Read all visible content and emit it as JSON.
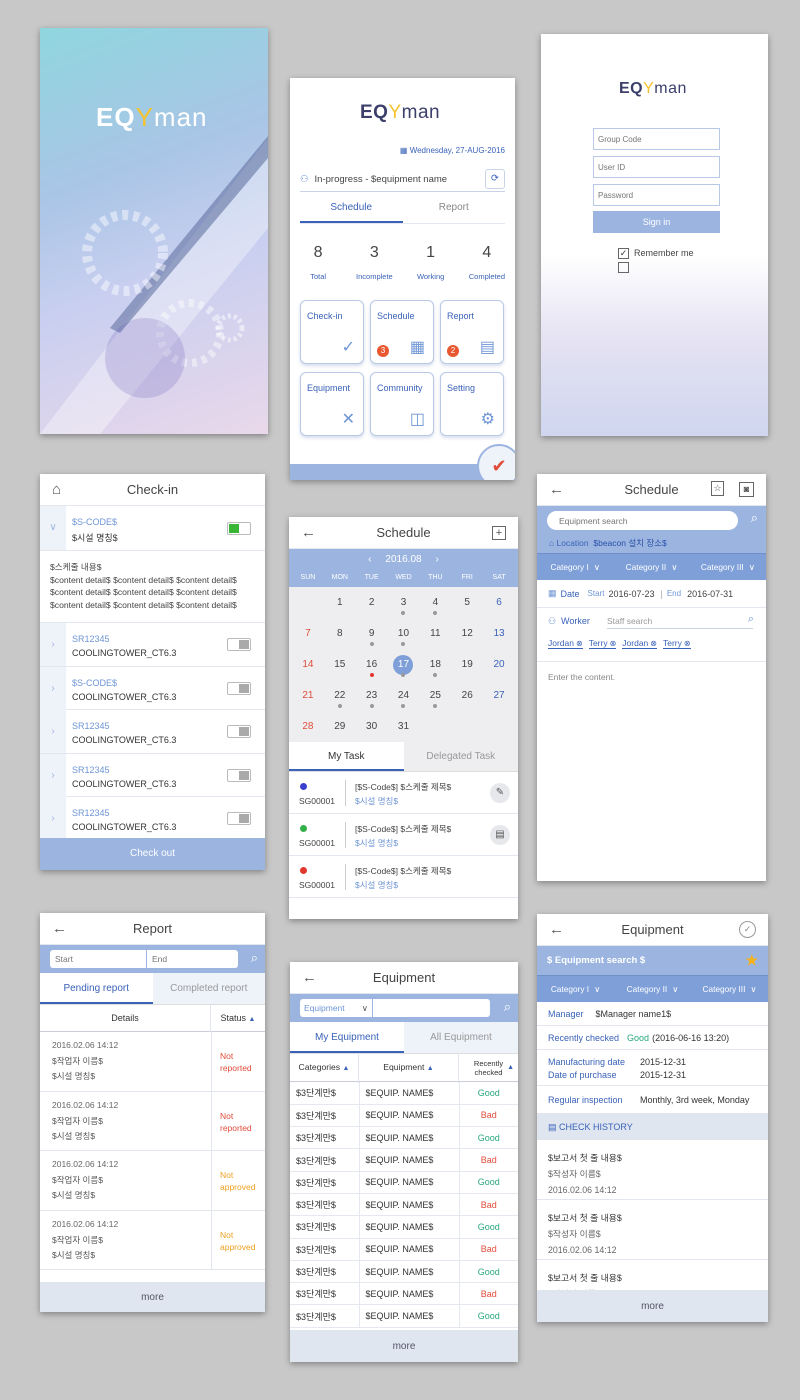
{
  "s1": {
    "logo_a": "EQ",
    "logo_b": "man"
  },
  "s2": {
    "logo_a": "EQ",
    "logo_b": "man",
    "date": "Wednesday, 27-AUG-2016",
    "status": "In-progress - $equipment name",
    "tabs": [
      "Schedule",
      "Report"
    ],
    "stats": [
      {
        "v": "8",
        "l": "Total"
      },
      {
        "v": "3",
        "l": "Incomplete"
      },
      {
        "v": "1",
        "l": "Working"
      },
      {
        "v": "4",
        "l": "Completed"
      }
    ],
    "tiles": [
      {
        "t": "Check-in",
        "ic": "✓",
        "b": ""
      },
      {
        "t": "Schedule",
        "ic": "▦",
        "b": "3"
      },
      {
        "t": "Report",
        "ic": "▤",
        "b": "2"
      },
      {
        "t": "Equipment",
        "ic": "✕",
        "b": ""
      },
      {
        "t": "Community",
        "ic": "◫",
        "b": ""
      },
      {
        "t": "Setting",
        "ic": "⚙",
        "b": ""
      }
    ]
  },
  "s3": {
    "logo_a": "EQ",
    "logo_b": "man",
    "group_ph": "Group Code",
    "user_ph": "User ID",
    "pw_ph": "Password",
    "signin": "Sign in",
    "remember": "Remember me"
  },
  "s4": {
    "title": "Check-in",
    "first": {
      "code": "$S-CODE$",
      "name": "$시설 명칭$"
    },
    "detail_head": "$스케줄 내용$",
    "detail_lines": [
      "$content detail$ $content detail$ $content detail$",
      "$content detail$ $content detail$ $content detail$",
      "$content detail$ $content detail$ $content detail$"
    ],
    "items": [
      {
        "code": "SR12345",
        "name": "COOLINGTOWER_CT6.3"
      },
      {
        "code": "$S-CODE$",
        "name": "COOLINGTOWER_CT6.3"
      },
      {
        "code": "SR12345",
        "name": "COOLINGTOWER_CT6.3"
      },
      {
        "code": "SR12345",
        "name": "COOLINGTOWER_CT6.3"
      },
      {
        "code": "SR12345",
        "name": "COOLINGTOWER_CT6.3"
      }
    ],
    "checkout": "Check out"
  },
  "s5": {
    "title": "Schedule",
    "month": "2016.08",
    "days": [
      "SUN",
      "MON",
      "TUE",
      "WED",
      "THU",
      "FRI",
      "SAT"
    ],
    "weeks": [
      [
        "",
        "1",
        "2",
        "3",
        "4",
        "5",
        "6"
      ],
      [
        "7",
        "8",
        "9",
        "10",
        "11",
        "12",
        "13"
      ],
      [
        "14",
        "15",
        "16",
        "17",
        "18",
        "19",
        "20"
      ],
      [
        "21",
        "22",
        "23",
        "24",
        "25",
        "26",
        "27"
      ],
      [
        "28",
        "29",
        "30",
        "31",
        "",
        "",
        ""
      ]
    ],
    "tabs": [
      "My Task",
      "Delegated Task"
    ],
    "tasks": [
      {
        "code": "SG00001",
        "title": "[$S-Code$] $스케줄 제목$",
        "sub": "$시설 명칭$",
        "dot": "#3b3fd0"
      },
      {
        "code": "SG00001",
        "title": "[$S-Code$] $스케줄 제목$",
        "sub": "$시설 명칭$",
        "dot": "#33b04a"
      },
      {
        "code": "SG00001",
        "title": "[$S-Code$] $스케줄 제목$",
        "sub": "$시설 명칭$",
        "dot": "#e0382f"
      }
    ]
  },
  "s6": {
    "title": "Schedule",
    "search_ph": "Equipment search",
    "loc_label": "Location",
    "loc_val": "$beacon 설치 장소$",
    "cats": [
      "Category I",
      "Category II",
      "Category III"
    ],
    "date_label": "Date",
    "start_label": "Start",
    "start": "2016-07-23",
    "end_label": "End",
    "end": "2016-07-31",
    "worker_label": "Worker",
    "staff_ph": "Staff search",
    "chips": [
      "Jordan",
      "Terry",
      "Jordan",
      "Terry"
    ],
    "content_ph": "Enter the content."
  },
  "s7": {
    "title": "Report",
    "start_ph": "Start",
    "end_ph": "End",
    "tabs": [
      "Pending report",
      "Completed report"
    ],
    "col_details": "Details",
    "col_status": "Status",
    "rows": [
      {
        "date": "2016.02.06 14:12",
        "worker": "$작업자 이름$",
        "name": "$시설 명칭$",
        "status": "Not reported",
        "c": "#e04c3a"
      },
      {
        "date": "2016.02.06 14:12",
        "worker": "$작업자 이름$",
        "name": "$시설 명칭$",
        "status": "Not reported",
        "c": "#e04c3a"
      },
      {
        "date": "2016.02.06 14:12",
        "worker": "$작업자 이름$",
        "name": "$시설 명칭$",
        "status": "Not approved",
        "c": "#f0a020"
      },
      {
        "date": "2016.02.06 14:12",
        "worker": "$작업자 이름$",
        "name": "$시설 명칭$",
        "status": "Not approved",
        "c": "#f0a020"
      }
    ],
    "more": "more"
  },
  "s8": {
    "title": "Equipment",
    "select": "Equipment",
    "tabs": [
      "My Equipment",
      "All Equipment"
    ],
    "cols": [
      "Categories",
      "Equipment",
      "Recently checked"
    ],
    "rows": [
      [
        "$3단계만$",
        "$EQUIP. NAME$",
        "Good"
      ],
      [
        "$3단계만$",
        "$EQUIP. NAME$",
        "Bad"
      ],
      [
        "$3단계만$",
        "$EQUIP. NAME$",
        "Good"
      ],
      [
        "$3단계만$",
        "$EQUIP. NAME$",
        "Bad"
      ],
      [
        "$3단계만$",
        "$EQUIP. NAME$",
        "Good"
      ],
      [
        "$3단계만$",
        "$EQUIP. NAME$",
        "Bad"
      ],
      [
        "$3단계만$",
        "$EQUIP. NAME$",
        "Good"
      ],
      [
        "$3단계만$",
        "$EQUIP. NAME$",
        "Bad"
      ],
      [
        "$3단계만$",
        "$EQUIP. NAME$",
        "Good"
      ],
      [
        "$3단계만$",
        "$EQUIP. NAME$",
        "Bad"
      ],
      [
        "$3단계만$",
        "$EQUIP. NAME$",
        "Good"
      ]
    ],
    "more": "more"
  },
  "s9": {
    "title": "Equipment",
    "search": "$ Equipment search $",
    "cats": [
      "Category I",
      "Category II",
      "Category III"
    ],
    "manager_label": "Manager",
    "manager": "$Manager name1$",
    "recent_label": "Recently checked",
    "recent_status": "Good",
    "recent_date": "(2016-06-16 13:20)",
    "mfg_label": "Manufacturing date",
    "mfg": "2015-12-31",
    "purchase_label": "Date of purchase",
    "purchase": "2015-12-31",
    "reg_label": "Regular inspection",
    "reg": "Monthly, 3rd week, Monday",
    "history": "CHECK HISTORY",
    "hist": [
      {
        "t": "$보고서 첫 줄 내용$",
        "w": "$작성자 이름$",
        "d": "2016.02.06 14:12"
      },
      {
        "t": "$보고서 첫 줄 내용$",
        "w": "$작성자 이름$",
        "d": "2016.02.06 14:12"
      },
      {
        "t": "$보고서 첫 줄 내용$",
        "w": "$작성자 이름$",
        "d": ""
      }
    ],
    "more": "more"
  },
  "colors": {
    "accent": "#3a62b8",
    "bar": "#9bb5e0",
    "good": "#28a87a",
    "bad": "#e04c3a",
    "warn": "#f0a020"
  }
}
